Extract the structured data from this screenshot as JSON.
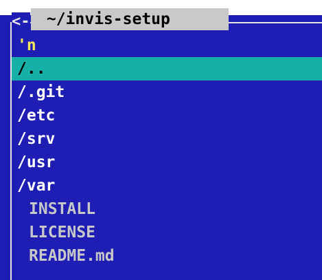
{
  "panel": {
    "back_glyph": "<-",
    "title": " ~/invis-setup"
  },
  "entries": [
    {
      "label": "'n"
    },
    {
      "label": "/.."
    },
    {
      "label": "/.git"
    },
    {
      "label": "/etc"
    },
    {
      "label": "/srv"
    },
    {
      "label": "/usr"
    },
    {
      "label": "/var"
    },
    {
      "label": "INSTALL"
    },
    {
      "label": "LICENSE"
    },
    {
      "label": "README.md"
    }
  ],
  "colors": {
    "panel_bg": "#1e1eb4",
    "selection_bg": "#17b0a9",
    "title_bg": "#c9c9c9",
    "quote_text": "#f5e85c"
  }
}
